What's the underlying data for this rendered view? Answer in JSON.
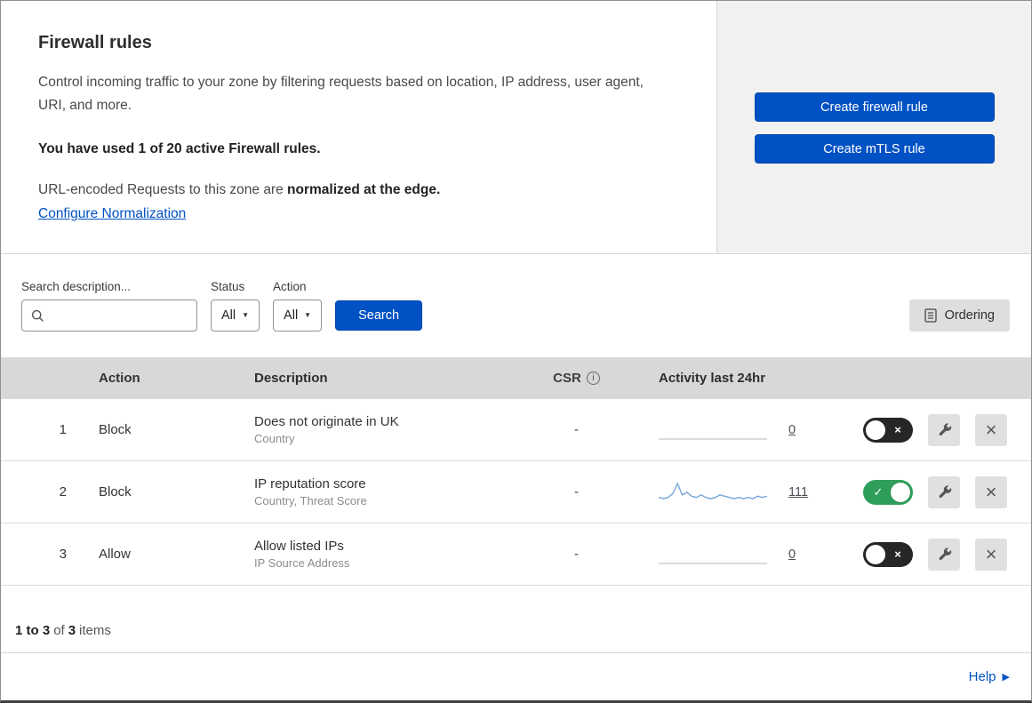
{
  "intro": {
    "title": "Firewall rules",
    "description": "Control incoming traffic to your zone by filtering requests based on location, IP address, user agent, URI, and more.",
    "usage": "You have used 1 of 20 active Firewall rules.",
    "normalization_prefix": "URL-encoded Requests to this zone are ",
    "normalization_bold": "normalized at the edge.",
    "normalization_link": "Configure Normalization",
    "create_firewall_button": "Create firewall rule",
    "create_mtls_button": "Create mTLS rule"
  },
  "toolbar": {
    "search_label": "Search description...",
    "search_value": "",
    "status_label": "Status",
    "status_value": "All",
    "action_label": "Action",
    "action_value": "All",
    "search_button": "Search",
    "ordering_button": "Ordering"
  },
  "table": {
    "columns": {
      "action": "Action",
      "description": "Description",
      "csr": "CSR",
      "activity": "Activity last 24hr"
    },
    "rows": [
      {
        "index": "1",
        "action": "Block",
        "description": "Does not originate in UK",
        "fields": "Country",
        "csr": "-",
        "activity_count": "0",
        "enabled": false,
        "sparkline": [
          0,
          0,
          0,
          0,
          0,
          0,
          0,
          0,
          0,
          0,
          0,
          0
        ]
      },
      {
        "index": "2",
        "action": "Block",
        "description": "IP reputation score",
        "fields": "Country, Threat Score",
        "csr": "-",
        "activity_count": "111",
        "enabled": true,
        "sparkline": [
          3,
          2,
          3,
          6,
          14,
          5,
          7,
          4,
          3,
          5,
          3,
          2,
          3,
          5,
          4,
          3,
          2,
          3,
          2,
          3,
          2,
          4,
          3,
          4
        ]
      },
      {
        "index": "3",
        "action": "Allow",
        "description": "Allow listed IPs",
        "fields": "IP Source Address",
        "csr": "-",
        "activity_count": "0",
        "enabled": false,
        "sparkline": [
          0,
          0,
          0,
          0,
          0,
          0,
          0,
          0,
          0,
          0,
          0,
          0
        ]
      }
    ]
  },
  "footer": {
    "range": "1 to 3",
    "of": "of",
    "total": "3",
    "items": "items"
  },
  "help": {
    "label": "Help"
  },
  "icons": {
    "check": "✓",
    "cross": "×",
    "caret_down": "▼",
    "info": "i",
    "help_arrow": "▶"
  },
  "colors": {
    "primary_blue": "#0051c3",
    "toggle_on_green": "#2f9e5b",
    "toggle_off_dark": "#262626",
    "sparkline_blue": "#76a7d7"
  }
}
